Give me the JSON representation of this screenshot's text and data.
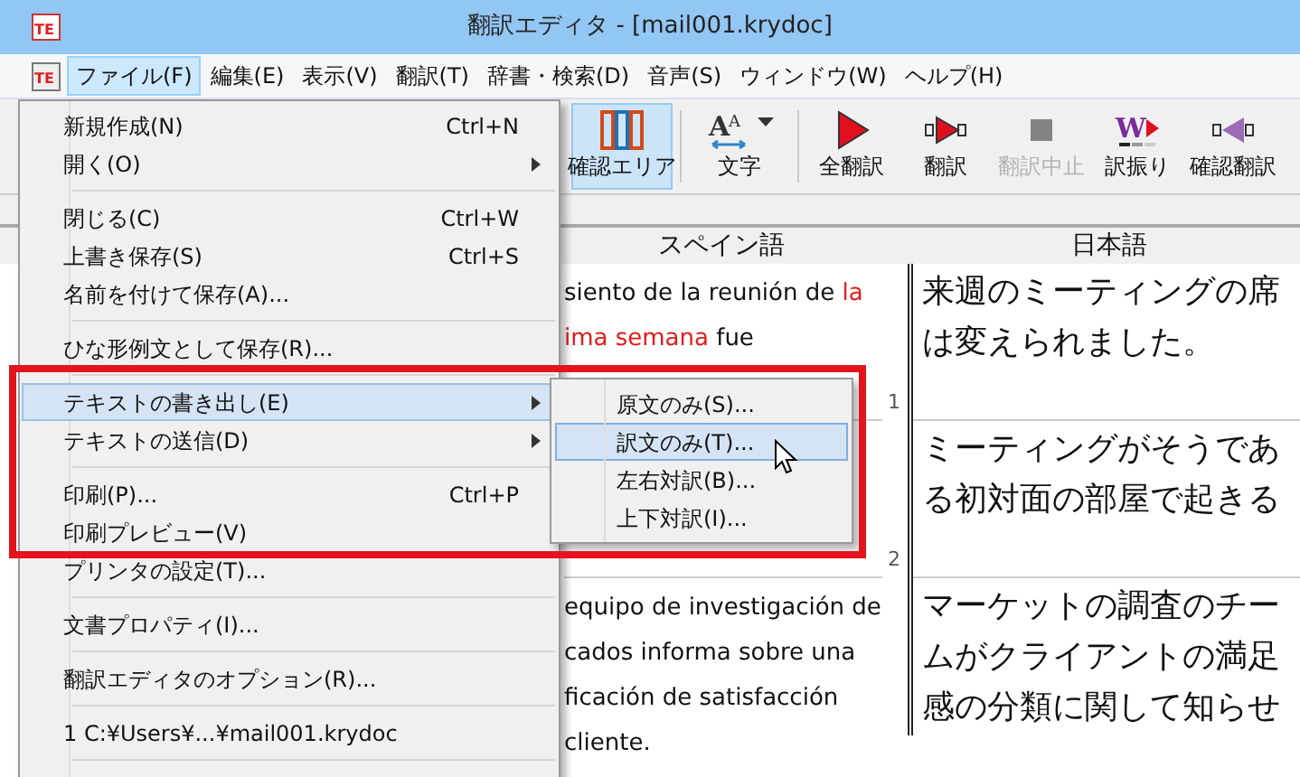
{
  "window": {
    "title": "翻訳エディタ - [mail001.krydoc]",
    "icon_text": "TE"
  },
  "menu_bar_icon_text": "TE",
  "menu_bar": [
    {
      "label": "ファイル(F)",
      "selected": true
    },
    {
      "label": "編集(E)",
      "selected": false
    },
    {
      "label": "表示(V)",
      "selected": false
    },
    {
      "label": "翻訳(T)",
      "selected": false
    },
    {
      "label": "辞書・検索(D)",
      "selected": false
    },
    {
      "label": "音声(S)",
      "selected": false
    },
    {
      "label": "ウィンドウ(W)",
      "selected": false
    },
    {
      "label": "ヘルプ(H)",
      "selected": false
    }
  ],
  "toolbar": [
    {
      "label": "確認エリア",
      "kind": "toggle",
      "selected": true,
      "disabled": false
    },
    {
      "kind": "separator"
    },
    {
      "label": "文字",
      "kind": "dropdown",
      "selected": false,
      "disabled": false,
      "icon_letters": [
        "A",
        "A"
      ]
    },
    {
      "kind": "separator"
    },
    {
      "label": "全翻訳",
      "kind": "button",
      "selected": false,
      "disabled": false
    },
    {
      "label": "翻訳",
      "kind": "button",
      "selected": false,
      "disabled": false
    },
    {
      "label": "翻訳中止",
      "kind": "button",
      "selected": false,
      "disabled": true
    },
    {
      "label": "訳振り",
      "kind": "button",
      "selected": false,
      "disabled": false,
      "icon_letters": [
        "W"
      ]
    },
    {
      "label": "確認翻訳",
      "kind": "button",
      "selected": false,
      "disabled": false
    }
  ],
  "columns": [
    "スペイン語",
    "日本語"
  ],
  "rows": [
    {
      "number": "1",
      "source": [
        [
          {
            "text": "siento de la reunión de ",
            "marked": false
          },
          {
            "text": "la",
            "marked": true
          }
        ],
        [
          {
            "text": "ima semana",
            "marked": true
          },
          {
            "text": " fue",
            "marked": false
          }
        ]
      ],
      "target": [
        "来週のミーティングの席",
        "は変えられました。"
      ]
    },
    {
      "number": "2",
      "source": [],
      "target": [
        "ミーティングがそうであ",
        "る初対面の部屋で起きる"
      ]
    },
    {
      "number": "",
      "source": [
        [
          {
            "text": "equipo de investigación de",
            "marked": false
          }
        ],
        [
          {
            "text": "cados informa sobre una",
            "marked": false
          }
        ],
        [
          {
            "text": "ficación de satisfacción",
            "marked": false
          }
        ],
        [
          {
            "text": "cliente.",
            "marked": false
          }
        ]
      ],
      "target": [
        "マーケットの調査のチー",
        "ムがクライアントの満足",
        "感の分類に関して知らせ"
      ]
    }
  ],
  "file_menu": [
    {
      "kind": "item",
      "label": "新規作成(N)",
      "shortcut": "Ctrl+N",
      "submenu": false,
      "selected": false
    },
    {
      "kind": "item",
      "label": "開く(O)",
      "submenu": true,
      "selected": false
    },
    {
      "kind": "separator"
    },
    {
      "kind": "item",
      "label": "閉じる(C)",
      "shortcut": "Ctrl+W",
      "submenu": false,
      "selected": false
    },
    {
      "kind": "item",
      "label": "上書き保存(S)",
      "shortcut": "Ctrl+S",
      "submenu": false,
      "selected": false
    },
    {
      "kind": "item",
      "label": "名前を付けて保存(A)...",
      "submenu": false,
      "selected": false
    },
    {
      "kind": "separator"
    },
    {
      "kind": "item",
      "label": "ひな形例文として保存(R)...",
      "submenu": false,
      "selected": false
    },
    {
      "kind": "separator"
    },
    {
      "kind": "item",
      "label": "テキストの書き出し(E)",
      "submenu": true,
      "selected": true
    },
    {
      "kind": "item",
      "label": "テキストの送信(D)",
      "submenu": true,
      "selected": false
    },
    {
      "kind": "separator"
    },
    {
      "kind": "item",
      "label": "印刷(P)...",
      "shortcut": "Ctrl+P",
      "submenu": false,
      "selected": false
    },
    {
      "kind": "item",
      "label": "印刷プレビュー(V)",
      "submenu": false,
      "selected": false
    },
    {
      "kind": "item",
      "label": "プリンタの設定(T)...",
      "submenu": false,
      "selected": false
    },
    {
      "kind": "separator"
    },
    {
      "kind": "item",
      "label": "文書プロパティ(I)...",
      "submenu": false,
      "selected": false
    },
    {
      "kind": "separator"
    },
    {
      "kind": "item",
      "label": "翻訳エディタのオプション(R)...",
      "submenu": false,
      "selected": false
    },
    {
      "kind": "separator"
    },
    {
      "kind": "item",
      "label": "1 C:¥Users¥...¥mail001.krydoc",
      "submenu": false,
      "selected": false
    },
    {
      "kind": "separator"
    }
  ],
  "export_submenu": [
    {
      "label": "原文のみ(S)...",
      "selected": false
    },
    {
      "label": "訳文のみ(T)...",
      "selected": true
    },
    {
      "label": "左右対訳(B)...",
      "selected": false
    },
    {
      "label": "上下対訳(I)...",
      "selected": false
    }
  ]
}
